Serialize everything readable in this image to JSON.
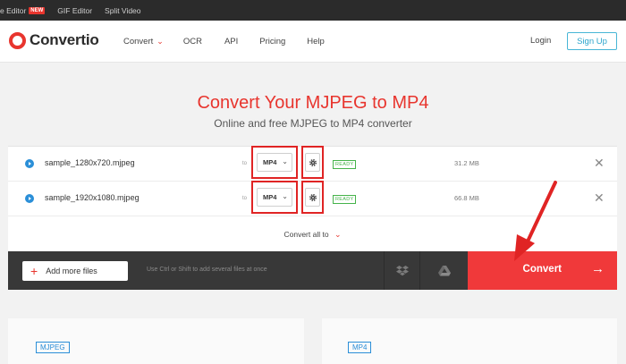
{
  "topbar": {
    "items": [
      {
        "label": "e Editor",
        "badge": "NEW"
      },
      {
        "label": "GIF Editor"
      },
      {
        "label": "Split Video"
      }
    ]
  },
  "nav": {
    "logo_text": "Convertio",
    "menu": [
      {
        "label": "Convert",
        "has_dropdown": true
      },
      {
        "label": "OCR"
      },
      {
        "label": "API"
      },
      {
        "label": "Pricing"
      },
      {
        "label": "Help"
      }
    ],
    "login": "Login",
    "signup": "Sign Up"
  },
  "hero": {
    "title": "Convert Your MJPEG to MP4",
    "subtitle": "Online and free MJPEG to MP4 converter"
  },
  "files": [
    {
      "name": "sample_1280x720.mjpeg",
      "to": "to",
      "format": "MP4",
      "status": "READY",
      "size": "31.2 MB"
    },
    {
      "name": "sample_1920x1080.mjpeg",
      "to": "to",
      "format": "MP4",
      "status": "READY",
      "size": "66.8 MB"
    }
  ],
  "convert_all": "Convert all to",
  "actions": {
    "add_files": "Add more files",
    "hint": "Use Ctrl or Shift to add several files at once",
    "convert": "Convert"
  },
  "cards": {
    "left_tag": "MJPEG",
    "right_tag": "MP4"
  },
  "colors": {
    "brand_red": "#e8352e",
    "convert_button": "#f0393a",
    "annotation_red": "#e02424",
    "link_blue": "#2ba4cc",
    "ready_green": "#45b34a"
  }
}
